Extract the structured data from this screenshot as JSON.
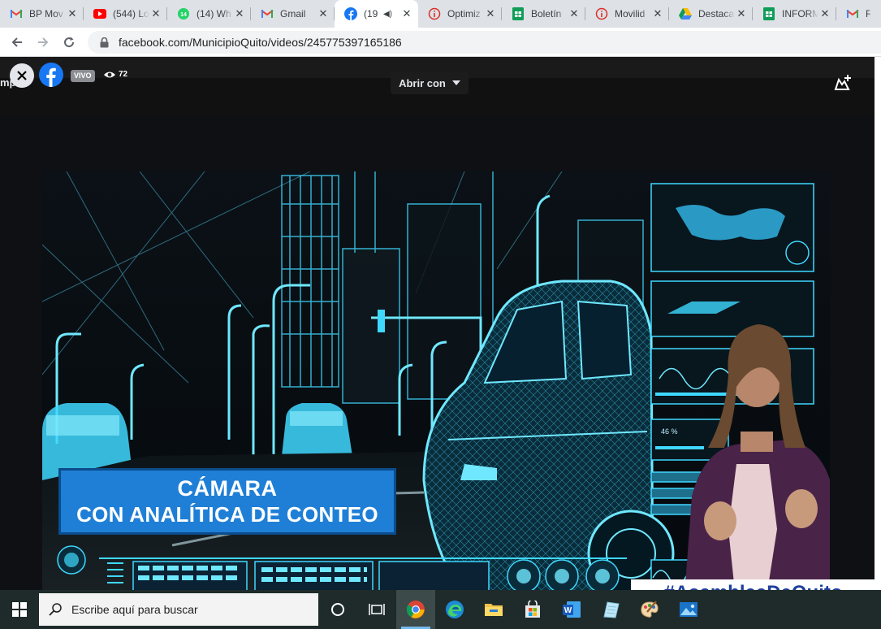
{
  "tabs": [
    {
      "title": "BP Mov",
      "icon": "gmail-icon"
    },
    {
      "title": "(544) Lo",
      "icon": "youtube-icon"
    },
    {
      "title": "(14) Wh",
      "icon": "whatsapp-icon"
    },
    {
      "title": "Gmail",
      "icon": "gmail-icon"
    },
    {
      "title": "(19",
      "icon": "facebook-icon",
      "active": true
    },
    {
      "title": "Optimiz",
      "icon": "info-icon"
    },
    {
      "title": "Boletín",
      "icon": "sheets-icon"
    },
    {
      "title": "Movilid",
      "icon": "info-icon"
    },
    {
      "title": "Destaca",
      "icon": "drive-icon"
    },
    {
      "title": "INFORM",
      "icon": "sheets-icon"
    },
    {
      "title": "Re",
      "icon": "gmail-icon"
    }
  ],
  "toolbar": {
    "url": "facebook.com/MunicipioQuito/videos/245775397165186"
  },
  "player": {
    "left_fragment": "mp",
    "live_label": "VIVO",
    "viewer_count": "72",
    "open_with_label": "Abrir con"
  },
  "video": {
    "caption_line1": "CÁMARA",
    "caption_line2": "CON ANALÍTICA DE CONTEO",
    "hashtag": "#AsambleaDeQuito",
    "hud_readout": "46 %"
  },
  "taskbar": {
    "search_placeholder": "Escribe aquí para buscar",
    "apps": [
      "task-view-icon",
      "chrome-icon",
      "edge-icon",
      "file-explorer-icon",
      "store-icon",
      "word-icon",
      "notes-icon",
      "paint-icon",
      "photos-icon"
    ]
  },
  "colors": {
    "hud_cyan": "#3fd8ff",
    "caption_blue": "#1f7fd6",
    "hashtag_blue": "#1e3f9c",
    "facebook_blue": "#1877f2"
  }
}
